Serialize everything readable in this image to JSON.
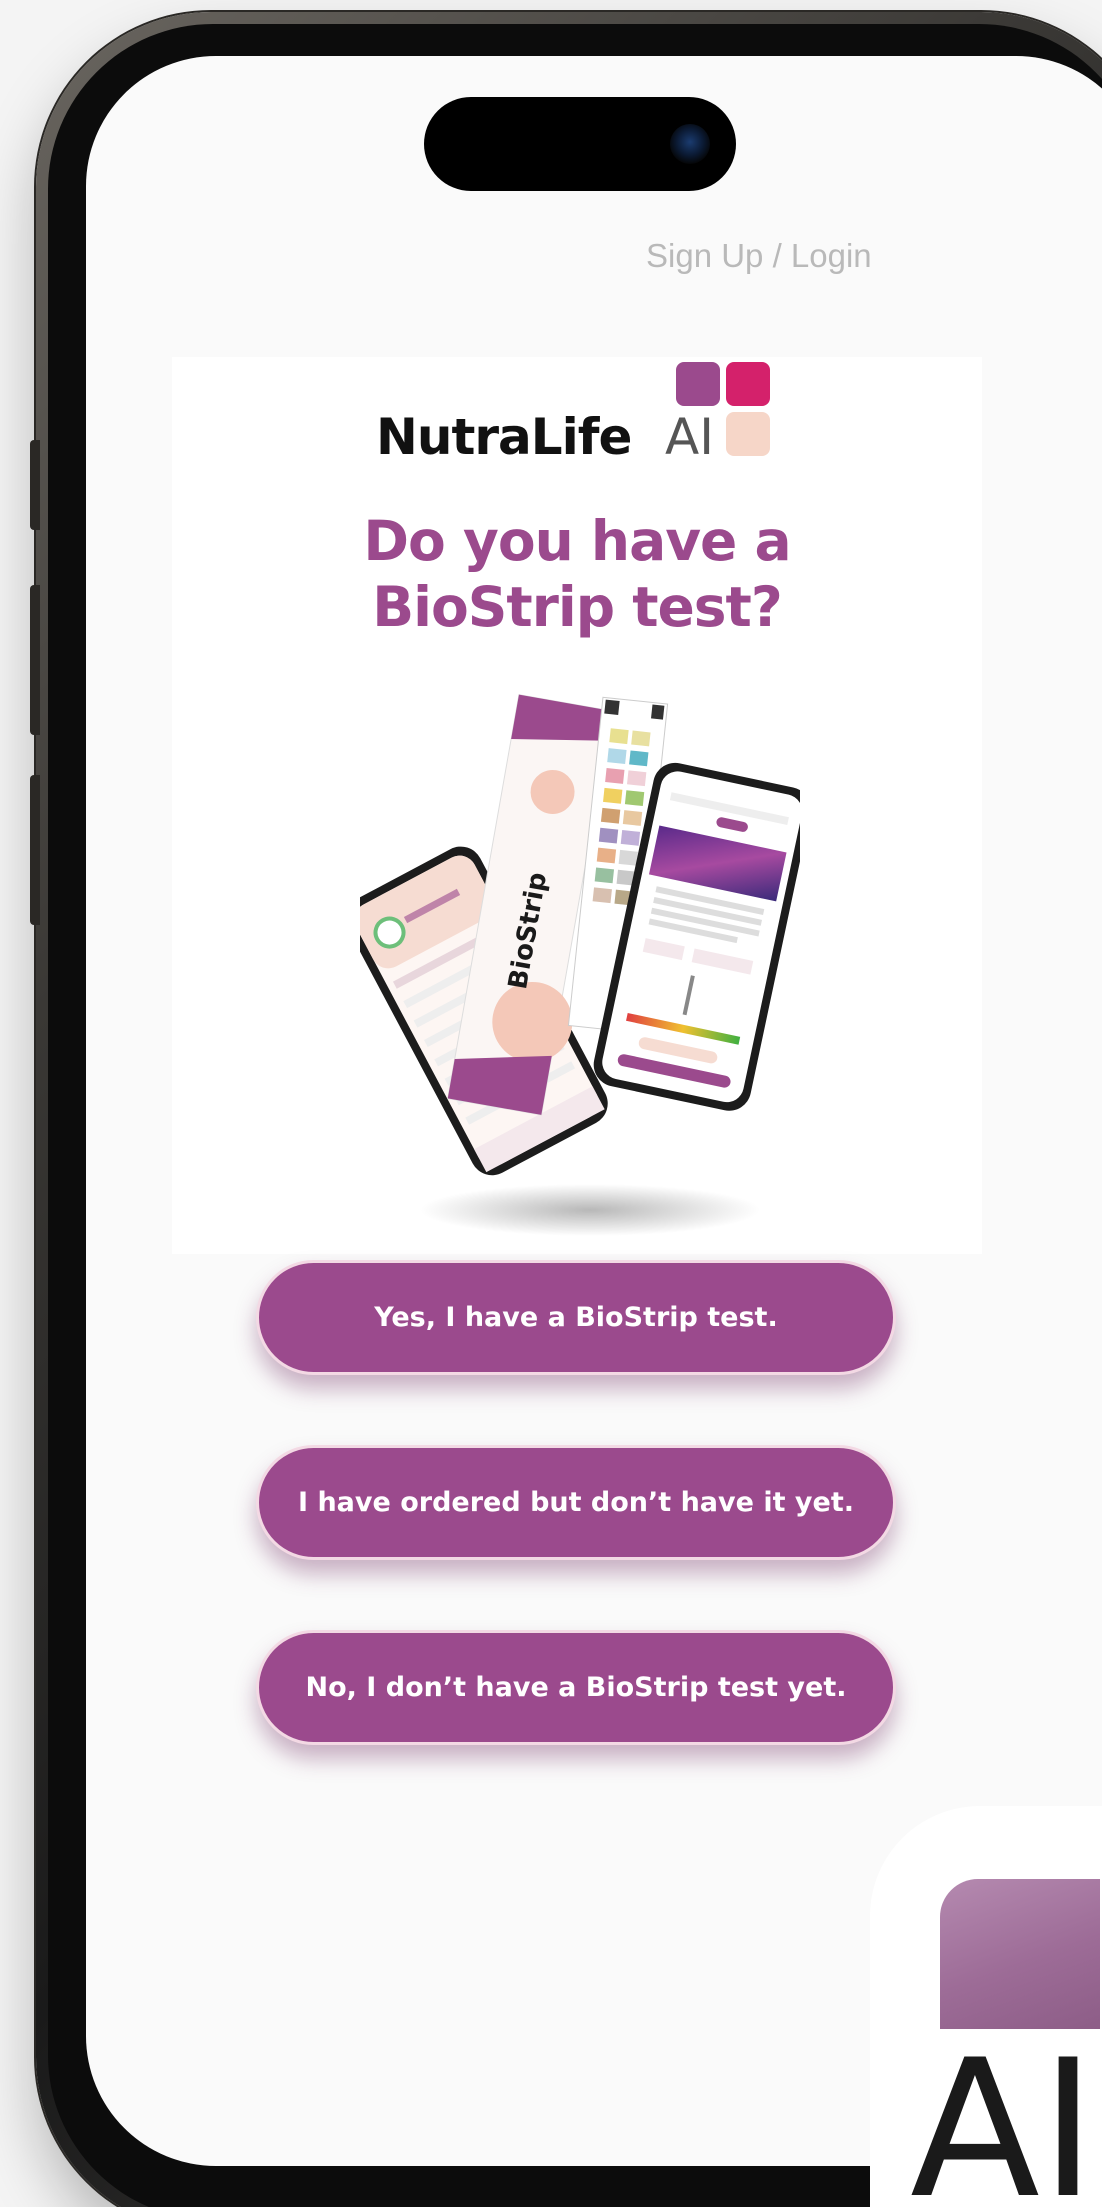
{
  "header": {
    "signup_login": "Sign Up / Login"
  },
  "brand": {
    "name": "NutraLife",
    "ai": "AI",
    "colors": {
      "primary": "#9b4a8d",
      "magenta": "#d4216b",
      "peach": "#f6d6c8",
      "button_border": "#f3d9e4"
    }
  },
  "question": {
    "line1": "Do you have a",
    "line2": "BioStrip test?"
  },
  "illustration": {
    "product_label": "BioStrip"
  },
  "options": [
    {
      "label": "Yes, I have a BioStrip test."
    },
    {
      "label": "I have ordered but don’t have it yet."
    },
    {
      "label": "No, I don’t have a BioStrip test yet."
    }
  ],
  "badge": {
    "text": "AI"
  }
}
